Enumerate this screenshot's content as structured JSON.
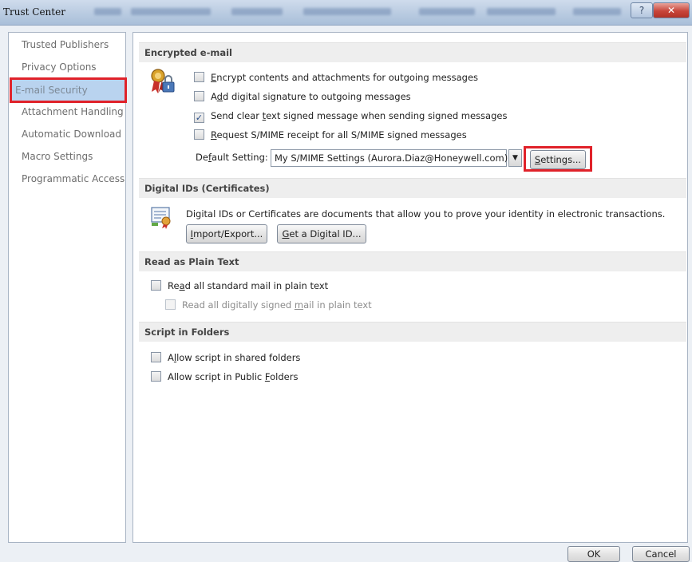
{
  "window": {
    "title": "Trust Center",
    "help_glyph": "?",
    "close_glyph": "✕"
  },
  "sidebar": {
    "items": [
      {
        "label": "Trusted Publishers"
      },
      {
        "label": "Privacy Options"
      },
      {
        "label": "E-mail Security",
        "selected": true
      },
      {
        "label": "Attachment Handling"
      },
      {
        "label": "Automatic Download"
      },
      {
        "label": "Macro Settings"
      },
      {
        "label": "Programmatic Access"
      }
    ]
  },
  "encrypted_email": {
    "header": "Encrypted e-mail",
    "options": [
      {
        "pre": "",
        "key": "E",
        "post": "ncrypt contents and attachments for outgoing messages",
        "checked": false
      },
      {
        "pre": "A",
        "key": "d",
        "post": "d digital signature to outgoing messages",
        "checked": false
      },
      {
        "pre": "Send clear ",
        "key": "t",
        "post": "ext signed message when sending signed messages",
        "checked": true
      },
      {
        "pre": "",
        "key": "R",
        "post": "equest S/MIME receipt for all S/MIME signed messages",
        "checked": false
      }
    ],
    "default_setting_pre": "De",
    "default_setting_key": "f",
    "default_setting_post": "ault Setting:",
    "default_setting_value": "My S/MIME Settings (Aurora.Diaz@Honeywell.com)",
    "settings_button_key": "S",
    "settings_button_rest": "ettings..."
  },
  "digital_ids": {
    "header": "Digital IDs (Certificates)",
    "description": "Digital IDs or Certificates are documents that allow you to prove your identity in electronic transactions.",
    "import_export_key": "I",
    "import_export_rest": "mport/Export...",
    "get_id_key": "G",
    "get_id_rest": "et a Digital ID..."
  },
  "plain_text": {
    "header": "Read as Plain Text",
    "read_all_pre": "Re",
    "read_all_key": "a",
    "read_all_post": "d all standard mail in plain text",
    "read_signed_pre": "Read all digitally signed ",
    "read_signed_key": "m",
    "read_signed_post": "ail in plain text"
  },
  "script_folders": {
    "header": "Script in Folders",
    "shared_pre": "A",
    "shared_key": "l",
    "shared_post": "low script in shared folders",
    "public_pre": "Allow script in Public ",
    "public_key": "F",
    "public_post": "olders"
  },
  "footer": {
    "ok_label": "OK",
    "cancel_label": "Cancel"
  },
  "colors": {
    "highlight": "#e0222a",
    "selection": "#b9d3ef"
  }
}
